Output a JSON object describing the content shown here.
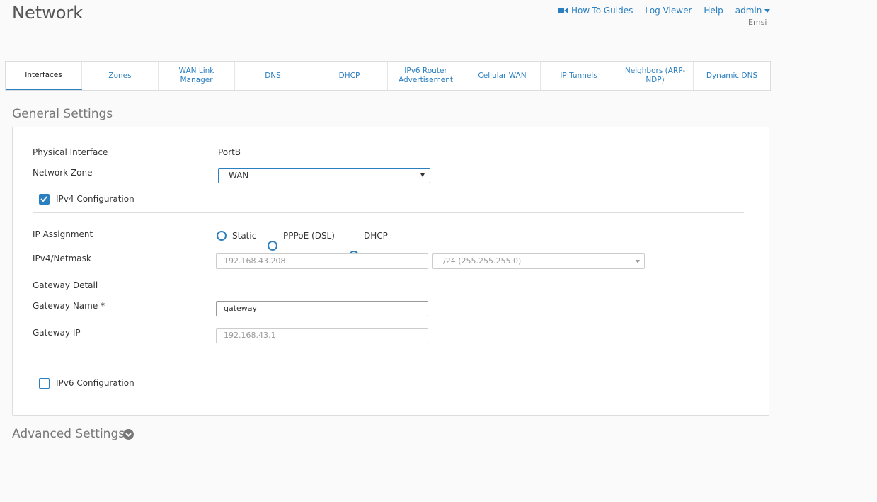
{
  "page": {
    "title": "Network"
  },
  "topnav": {
    "howto": "How-To Guides",
    "logviewer": "Log Viewer",
    "help": "Help",
    "user": "admin",
    "user_sub": "Emsi"
  },
  "tabs": [
    {
      "label": "Interfaces",
      "active": true
    },
    {
      "label": "Zones"
    },
    {
      "label": "WAN Link Manager"
    },
    {
      "label": "DNS"
    },
    {
      "label": "DHCP"
    },
    {
      "label": "IPv6 Router Advertisement"
    },
    {
      "label": "Cellular WAN"
    },
    {
      "label": "IP Tunnels"
    },
    {
      "label": "Neighbors (ARP-NDP)"
    },
    {
      "label": "Dynamic DNS"
    }
  ],
  "general": {
    "title": "General Settings",
    "physical_interface_label": "Physical Interface",
    "physical_interface_value": "PortB",
    "network_zone_label": "Network Zone",
    "network_zone_value": "WAN",
    "ipv4_config_label": "IPv4 Configuration",
    "ipv4_config_checked": true,
    "ip_assignment_label": "IP Assignment",
    "ip_assignment_options": [
      "Static",
      "PPPoE (DSL)",
      "DHCP"
    ],
    "ip_assignment_selected": "DHCP",
    "ipv4_netmask_label": "IPv4/Netmask",
    "ipv4_value": "192.168.43.208",
    "netmask_value": "/24 (255.255.255.0)",
    "gateway_detail_label": "Gateway Detail",
    "gateway_name_label": "Gateway Name *",
    "gateway_name_value": "gateway",
    "gateway_ip_label": "Gateway IP",
    "gateway_ip_value": "192.168.43.1",
    "ipv6_config_label": "IPv6 Configuration",
    "ipv6_config_checked": false
  },
  "advanced": {
    "title": "Advanced Settings"
  },
  "colors": {
    "accent": "#2a7fc0",
    "muted_text": "#777777"
  }
}
